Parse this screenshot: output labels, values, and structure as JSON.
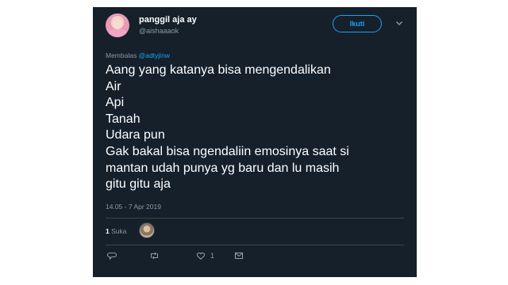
{
  "user": {
    "display_name": "panggil aja ay",
    "handle": "@aishaaaok"
  },
  "follow_label": "Ikuti",
  "reply_prefix": "Membalas",
  "reply_mention": "@adtyjinw",
  "tweet_lines": [
    "Aang yang katanya bisa mengendalikan",
    "Air",
    "Api",
    "Tanah",
    "Udara pun",
    "Gak bakal bisa ngendaliin emosinya saat si",
    "mantan udah punya yg baru dan lu masih",
    "gitu gitu aja"
  ],
  "timestamp": "14.05 - 7 Apr 2019",
  "likes": {
    "count": "1",
    "label": "Suka"
  },
  "actions": {
    "like_count": "1"
  },
  "colors": {
    "background": "#15202b",
    "accent": "#1da1f2",
    "muted": "#8899a6"
  },
  "icons": [
    "reply-icon",
    "retweet-icon",
    "heart-icon",
    "message-icon",
    "chevron-down-icon"
  ]
}
